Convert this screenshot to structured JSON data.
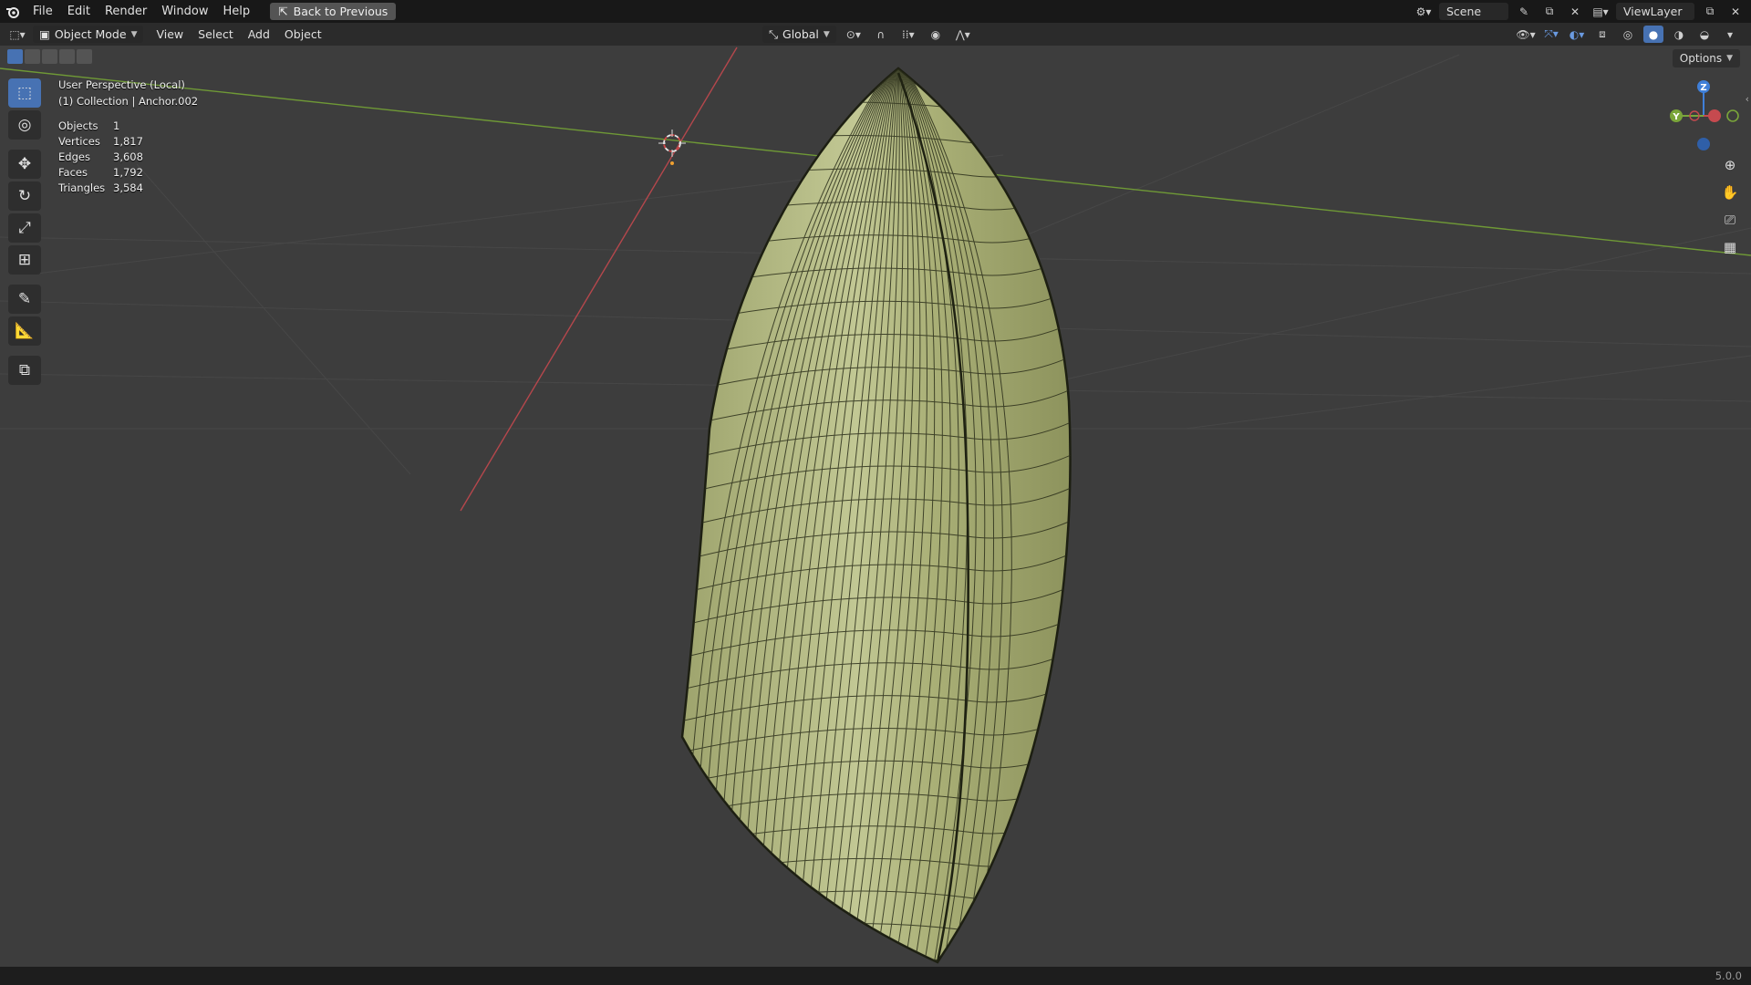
{
  "menu": {
    "items": [
      "File",
      "Edit",
      "Render",
      "Window",
      "Help"
    ],
    "back_button": "Back to Previous"
  },
  "topbar": {
    "scene_name": "Scene",
    "view_layer": "ViewLayer"
  },
  "header": {
    "mode": "Object Mode",
    "menus": [
      "View",
      "Select",
      "Add",
      "Object"
    ],
    "orientation": "Global"
  },
  "viewport": {
    "view_name": "User Perspective (Local)",
    "collection_info": "(1) Collection | Anchor.002",
    "stats": [
      {
        "label": "Objects",
        "value": "1"
      },
      {
        "label": "Vertices",
        "value": "1,817"
      },
      {
        "label": "Edges",
        "value": "3,608"
      },
      {
        "label": "Faces",
        "value": "1,792"
      },
      {
        "label": "Triangles",
        "value": "3,584"
      }
    ],
    "options_label": "Options",
    "gizmo": {
      "z": "Z",
      "y": "Y"
    }
  },
  "statusbar": {
    "version": "5.0.0"
  },
  "colors": {
    "accent": "#4772b3",
    "mesh": "#b4bd86",
    "x_axis": "#c64a4f",
    "y_axis": "#7aa53a",
    "z_axis": "#3f7fd8"
  }
}
